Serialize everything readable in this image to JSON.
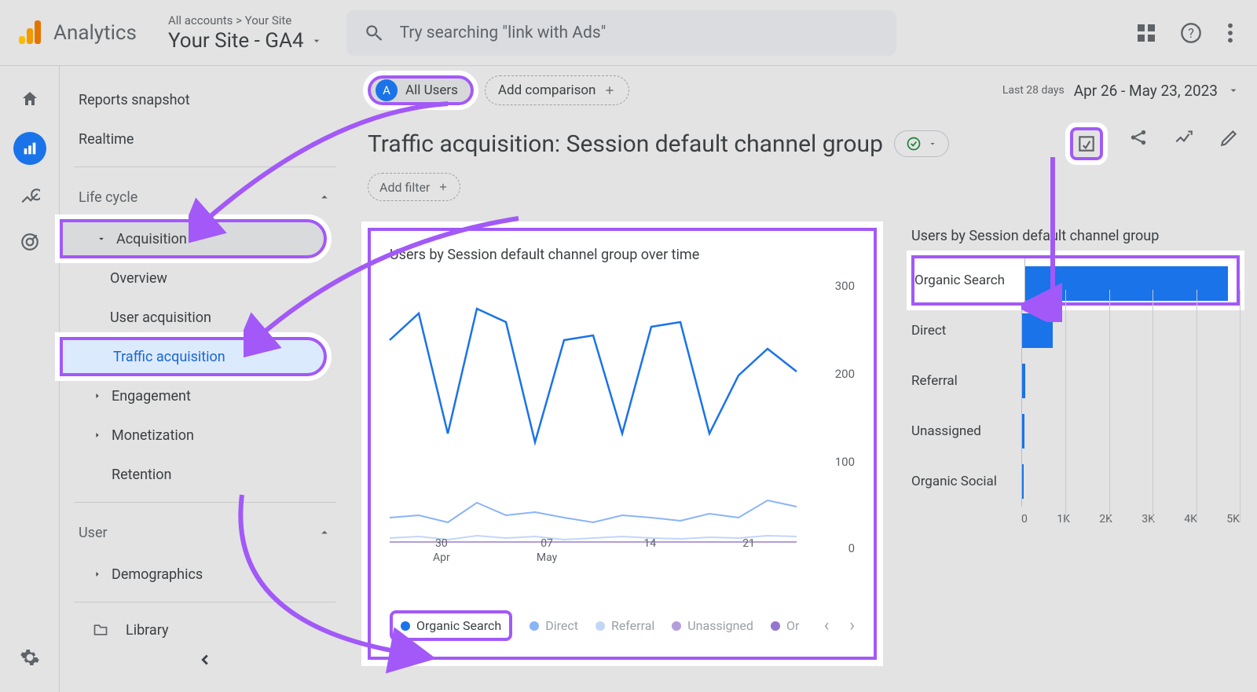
{
  "header": {
    "product": "Analytics",
    "breadcrumb": "All accounts > Your Site",
    "site_picker": "Your Site - GA4",
    "search_placeholder": "Try searching \"link with Ads\""
  },
  "sidebar": {
    "snapshot": "Reports snapshot",
    "realtime": "Realtime",
    "section_lifecycle": "Life cycle",
    "acquisition": "Acquisition",
    "overview": "Overview",
    "user_acq": "User acquisition",
    "traffic_acq": "Traffic acquisition",
    "engagement": "Engagement",
    "monetization": "Monetization",
    "retention": "Retention",
    "section_user": "User",
    "demographics": "Demographics",
    "library": "Library"
  },
  "top": {
    "all_users": "All Users",
    "add_comparison": "Add comparison",
    "date_label": "Last 28 days",
    "date_range": "Apr 26 - May 23, 2023"
  },
  "page": {
    "title": "Traffic acquisition: Session default channel group",
    "add_filter": "Add filter"
  },
  "line_card": {
    "title": "Users by Session default channel group over time"
  },
  "bar_card": {
    "title": "Users by Session default channel group"
  },
  "legend": {
    "organic_search": "Organic Search",
    "direct": "Direct",
    "referral": "Referral",
    "unassigned": "Unassigned",
    "organic_partial": "Or"
  },
  "chart_data": [
    {
      "type": "line",
      "title": "Users by Session default channel group over time",
      "xlabel": "",
      "ylabel": "",
      "ylim": [
        0,
        300
      ],
      "x_tick_labels": [
        "30 Apr",
        "07 May",
        "14",
        "21"
      ],
      "y_tick_labels": [
        "0",
        "100",
        "200",
        "300"
      ],
      "series": [
        {
          "name": "Organic Search",
          "color": "#1a73e8",
          "values": [
            235,
            270,
            130,
            270,
            255,
            120,
            235,
            240,
            130,
            250,
            255,
            130,
            195,
            225,
            200
          ]
        },
        {
          "name": "Direct",
          "color": "#8ab4f8",
          "values": [
            35,
            38,
            30,
            52,
            38,
            42,
            35,
            30,
            38,
            35,
            32,
            40,
            35,
            55,
            48
          ]
        },
        {
          "name": "Referral",
          "color": "#c2d6f7",
          "values": [
            12,
            14,
            10,
            15,
            12,
            14,
            10,
            12,
            14,
            12,
            11,
            13,
            12,
            15,
            14
          ]
        },
        {
          "name": "Unassigned",
          "color": "#b39ddb",
          "values": [
            8,
            9,
            7,
            10,
            8,
            9,
            7,
            8,
            9,
            8,
            7,
            9,
            8,
            10,
            9
          ]
        },
        {
          "name": "Organic Social",
          "color": "#9575cd",
          "values": [
            4,
            5,
            3,
            6,
            4,
            5,
            3,
            4,
            5,
            4,
            3,
            5,
            4,
            6,
            5
          ]
        }
      ]
    },
    {
      "type": "bar",
      "title": "Users by Session default channel group",
      "orientation": "horizontal",
      "categories": [
        "Organic Search",
        "Direct",
        "Referral",
        "Unassigned",
        "Organic Social"
      ],
      "values": [
        4800,
        700,
        80,
        50,
        30
      ],
      "xlim": [
        0,
        5000
      ],
      "x_tick_labels": [
        "0",
        "1K",
        "2K",
        "3K",
        "4K",
        "5K"
      ]
    }
  ]
}
